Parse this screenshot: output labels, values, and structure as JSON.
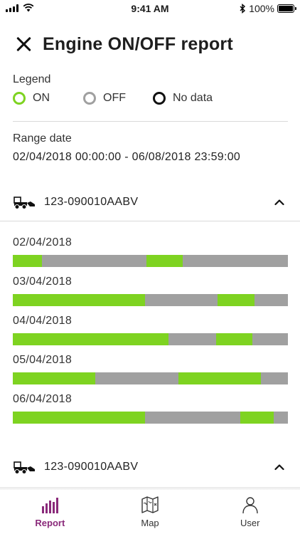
{
  "status_bar": {
    "time": "9:41 AM",
    "battery_text": "100%"
  },
  "header": {
    "title": "Engine ON/OFF report",
    "close_icon": "close-icon"
  },
  "legend": {
    "title": "Legend",
    "items": [
      {
        "label": "ON",
        "color": "#7ed321"
      },
      {
        "label": "OFF",
        "color": "#a0a0a0"
      },
      {
        "label": "No data",
        "color": "#111111"
      }
    ]
  },
  "range": {
    "title": "Range date",
    "value": "02/04/2018 00:00:00 - 06/08/2018 23:59:00"
  },
  "colors": {
    "on": "#7ed321",
    "off": "#a0a0a0",
    "accent": "#8a2a7a"
  },
  "vehicles": [
    {
      "name": "123-090010AABV",
      "icon": "loader-truck-icon",
      "expanded": true,
      "days": [
        {
          "date": "02/04/2018",
          "on_segments": [
            [
              0.0,
              0.105
            ],
            [
              0.487,
              0.617
            ]
          ]
        },
        {
          "date": "03/04/2018",
          "on_segments": [
            [
              0.0,
              0.48
            ],
            [
              0.745,
              0.878
            ]
          ]
        },
        {
          "date": "04/04/2018",
          "on_segments": [
            [
              0.0,
              0.565
            ],
            [
              0.739,
              0.87
            ]
          ]
        },
        {
          "date": "05/04/2018",
          "on_segments": [
            [
              0.0,
              0.3
            ],
            [
              0.601,
              0.902
            ]
          ]
        },
        {
          "date": "06/04/2018",
          "on_segments": [
            [
              0.0,
              0.48
            ],
            [
              0.827,
              0.949
            ]
          ]
        }
      ]
    },
    {
      "name": "123-090010AABV",
      "icon": "loader-truck-icon",
      "expanded": true
    }
  ],
  "tabs": [
    {
      "label": "Report",
      "icon": "bar-chart-icon",
      "active": true
    },
    {
      "label": "Map",
      "icon": "map-icon",
      "active": false
    },
    {
      "label": "User",
      "icon": "user-icon",
      "active": false
    }
  ]
}
